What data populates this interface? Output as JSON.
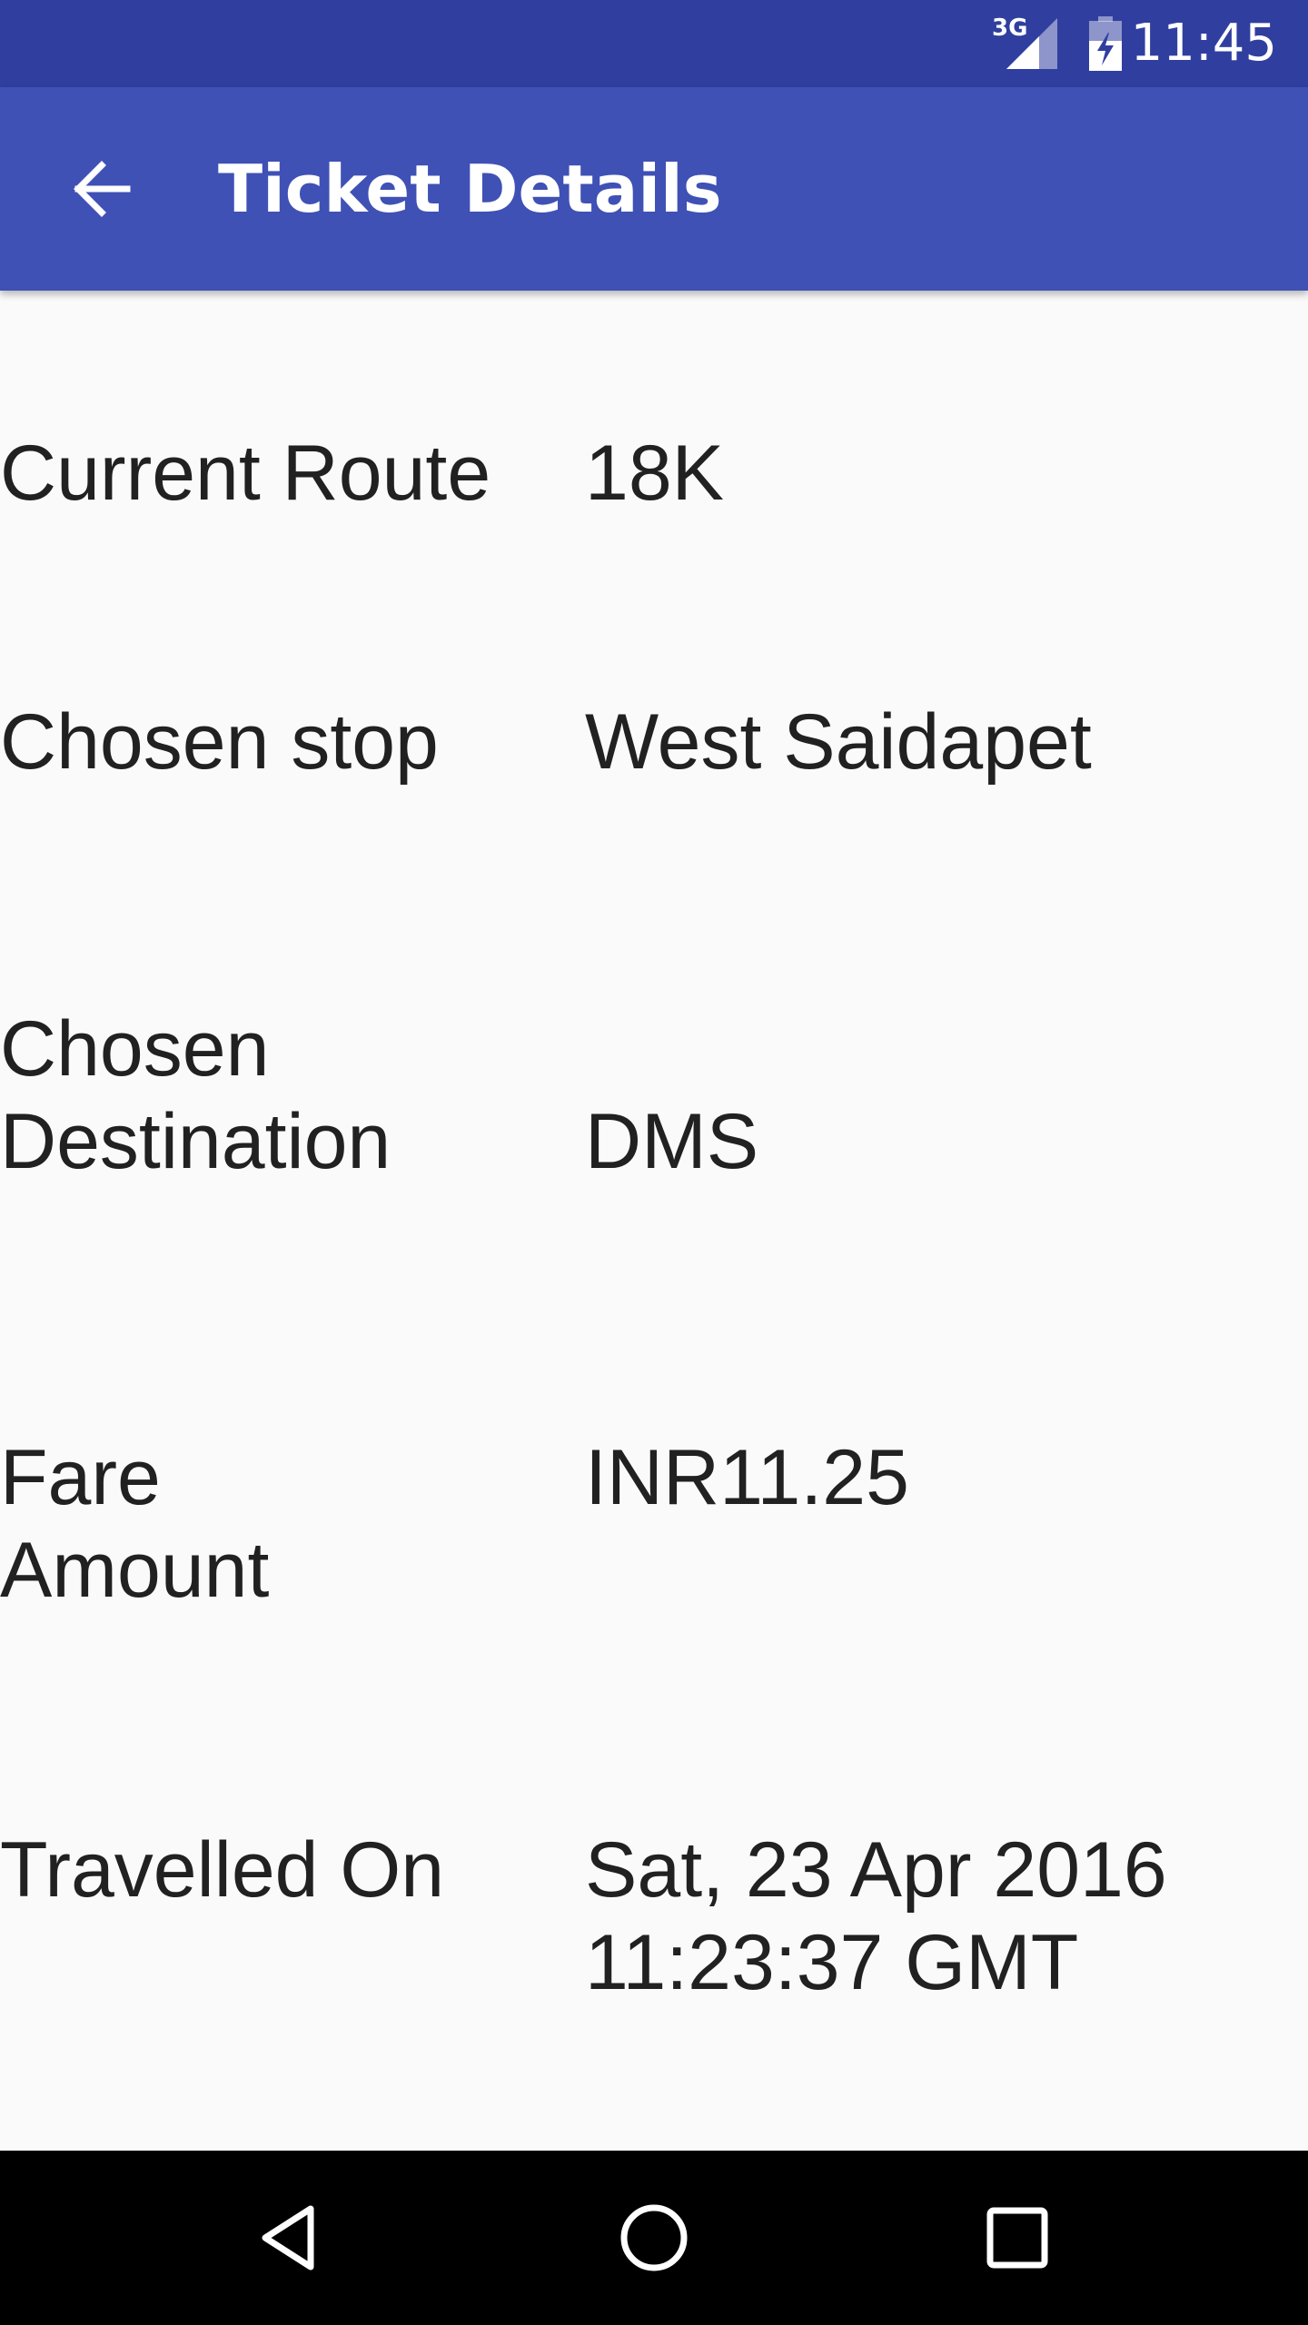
{
  "status_bar": {
    "time": "11:45",
    "network_label": "3G",
    "icons": [
      "signal-icon",
      "battery-charging-icon"
    ]
  },
  "app_bar": {
    "title": "Ticket Details",
    "back_icon": "back-arrow-icon"
  },
  "details": [
    {
      "label": "Current Route",
      "value": "18K"
    },
    {
      "label": "Chosen stop",
      "value": "West Saidapet"
    },
    {
      "label": "Chosen Destination",
      "value": "DMS"
    },
    {
      "label": "Fare Amount",
      "value": "INR11.25"
    },
    {
      "label": "Travelled On",
      "value": "Sat, 23 Apr 2016 11:23:37 GMT"
    }
  ],
  "nav_bar": {
    "icons": [
      "nav-back-icon",
      "nav-home-icon",
      "nav-recents-icon"
    ]
  },
  "colors": {
    "status_bar": "#303F9F",
    "app_bar": "#3F51B5",
    "background": "#FAFAFA",
    "text": "#212121",
    "nav_bar": "#000000"
  }
}
